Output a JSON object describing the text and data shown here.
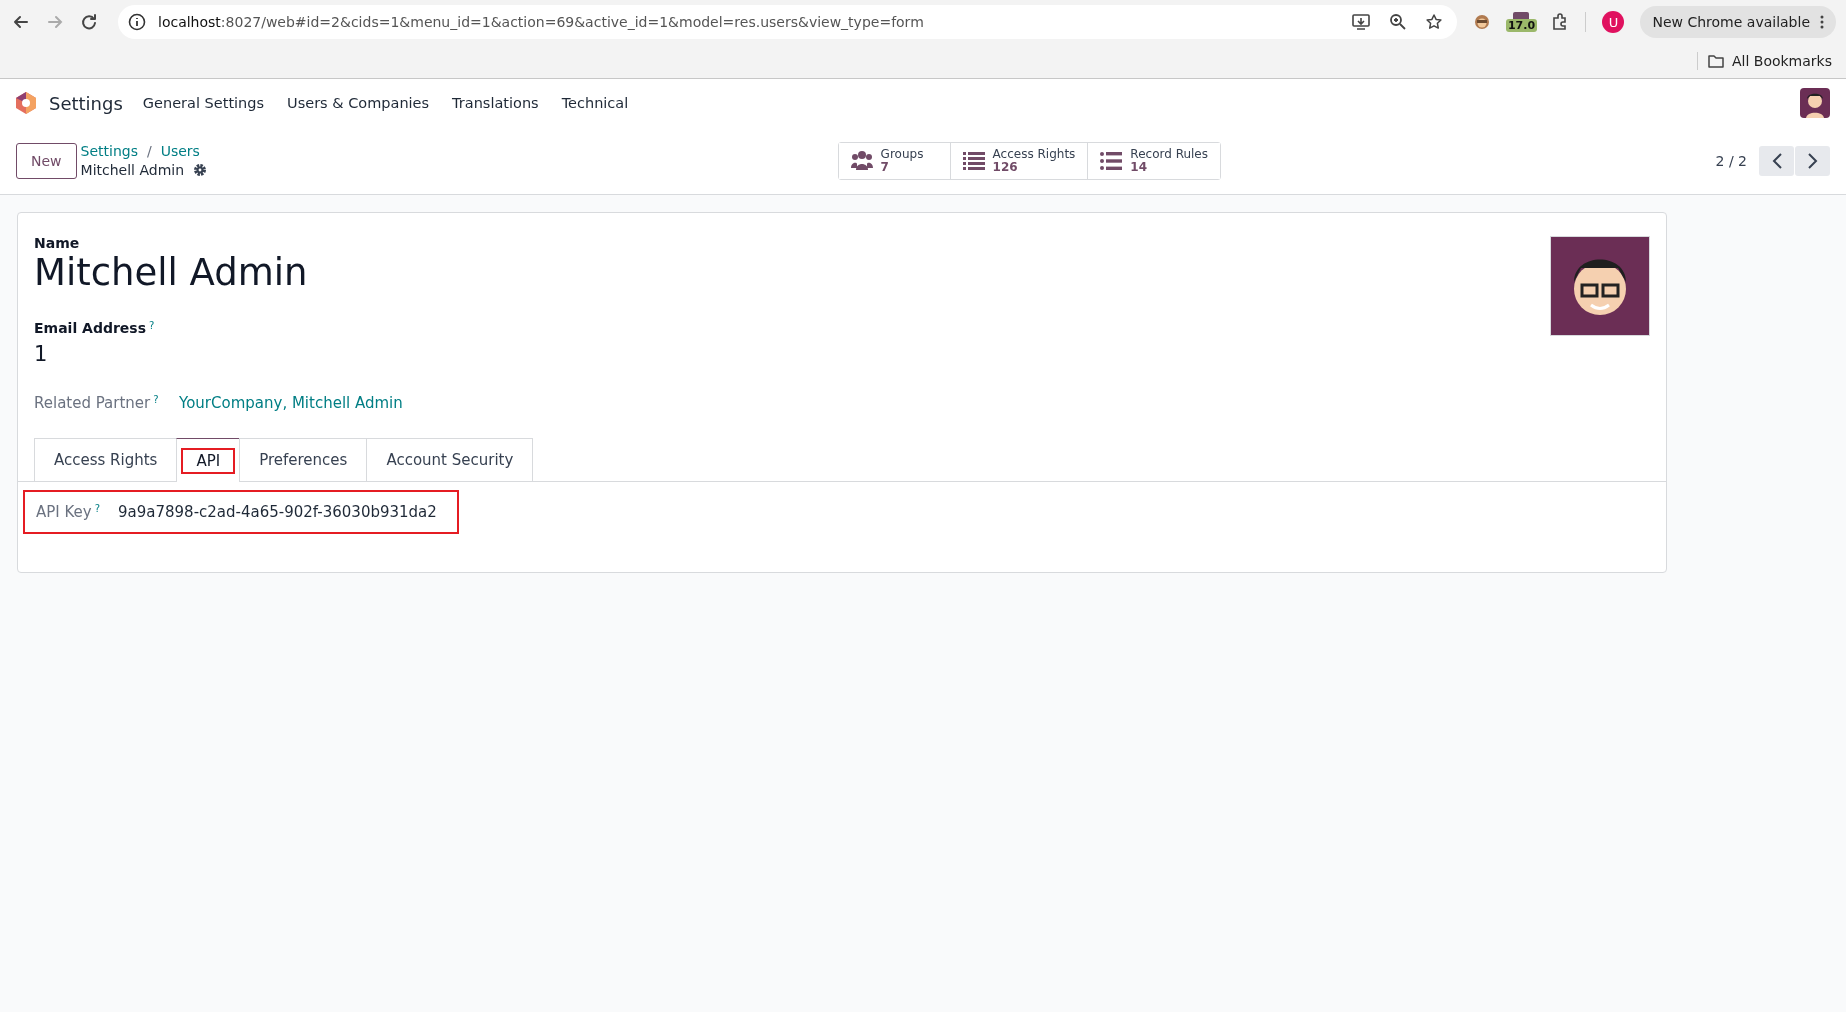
{
  "browser": {
    "url_host": "localhost",
    "url_rest": ":8027/web#id=2&cids=1&menu_id=1&action=69&active_id=1&model=res.users&view_type=form",
    "extension_badge": "17.0",
    "profile_initial": "U",
    "update_button": "New Chrome available",
    "bookmarks": "All Bookmarks"
  },
  "app": {
    "title": "Settings",
    "menu": [
      "General Settings",
      "Users & Companies",
      "Translations",
      "Technical"
    ]
  },
  "control_panel": {
    "new_button": "New",
    "breadcrumbs": [
      "Settings",
      "Users"
    ],
    "breadcrumb_separator": "/",
    "record": "Mitchell Admin",
    "stat_buttons": [
      {
        "kind": "users",
        "label": "Groups",
        "value": "7"
      },
      {
        "kind": "list",
        "label": "Access Rights",
        "value": "126"
      },
      {
        "kind": "bullets",
        "label": "Record Rules",
        "value": "14"
      }
    ],
    "pager": "2 / 2"
  },
  "form": {
    "name_label": "Name",
    "name": "Mitchell Admin",
    "email_label": "Email Address",
    "email_help": "?",
    "email": "1",
    "partner_label": "Related Partner",
    "partner_help": "?",
    "partner": "YourCompany, Mitchell Admin",
    "tabs": [
      {
        "label": "Access Rights",
        "selected": false,
        "highlighted": false
      },
      {
        "label": "API",
        "selected": true,
        "highlighted": true
      },
      {
        "label": "Preferences",
        "selected": false,
        "highlighted": false
      },
      {
        "label": "Account Security",
        "selected": false,
        "highlighted": false
      }
    ],
    "api_key": {
      "label": "API Key",
      "help": "?",
      "value": "9a9a7898-c2ad-4a65-902f-36030b931da2",
      "highlighted": true
    }
  }
}
